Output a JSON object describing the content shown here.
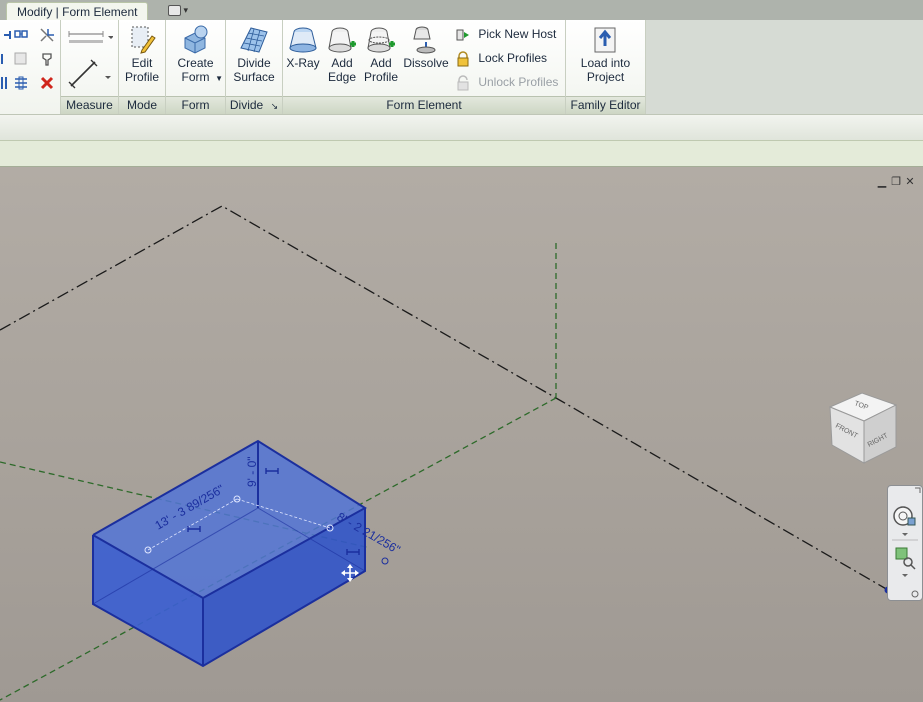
{
  "tab": {
    "active_label": "Modify | Form Element"
  },
  "quick_access": {
    "icon": "quick-access-dropdown"
  },
  "ribbon": {
    "panels": {
      "modify_label": "",
      "measure_label": "Measure",
      "mode_label": "Mode",
      "form_label": "Form",
      "divide_label": "Divide",
      "form_element_label": "Form Element",
      "family_editor_label": "Family Editor"
    },
    "mode": {
      "edit_profile_line1": "Edit",
      "edit_profile_line2": "Profile"
    },
    "form": {
      "create_form_line1": "Create",
      "create_form_line2": "Form"
    },
    "divide": {
      "divide_surface_line1": "Divide",
      "divide_surface_line2": "Surface",
      "launcher": "↘"
    },
    "form_element": {
      "xray": "X-Ray",
      "add_edge_line1": "Add",
      "add_edge_line2": "Edge",
      "add_profile_line1": "Add",
      "add_profile_line2": "Profile",
      "dissolve": "Dissolve",
      "pick_new_host": "Pick  New Host",
      "lock_profiles": "Lock  Profiles",
      "unlock_profiles": "Unlock  Profiles"
    },
    "family_editor": {
      "load_line1": "Load into",
      "load_line2": "Project"
    }
  },
  "viewport": {
    "dimensions": {
      "length": "13' - 3 89/256\"",
      "height": "9' - 0\"",
      "width": "8' - 2 21/256\""
    },
    "viewcube": {
      "top": "TOP",
      "front": "FRONT",
      "right": "RIGHT"
    }
  },
  "colors": {
    "form_fill": "#3a5fd0",
    "form_edge": "#1b2f9e",
    "dimension": "#1b2f9e",
    "reference_green": "#2d6a2a",
    "reference_black": "#1a1a1a",
    "ribbon_accent": "#d5e6c0"
  }
}
